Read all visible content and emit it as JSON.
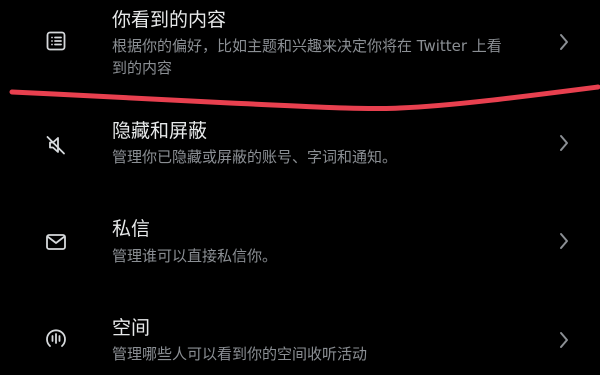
{
  "settings_rows": [
    {
      "title": "你看到的内容",
      "description": "根据你的偏好，比如主题和兴趣来决定你将在 Twitter 上看到的内容",
      "icon": "list-document-icon"
    },
    {
      "title": "隐藏和屏蔽",
      "description": "管理你已隐藏或屏蔽的账号、字词和通知。",
      "icon": "muted-speaker-icon"
    },
    {
      "title": "私信",
      "description": "管理谁可以直接私信你。",
      "icon": "envelope-icon"
    },
    {
      "title": "空间",
      "description": "管理哪些人可以看到你的空间收听活动",
      "icon": "spaces-microphone-icon"
    }
  ],
  "colors": {
    "background": "#000000",
    "title": "#e7e9ea",
    "description": "#8b8f94",
    "icon": "#d6d9dc",
    "chevron": "#8b8f94",
    "annotation_stroke": "#e8404f"
  }
}
